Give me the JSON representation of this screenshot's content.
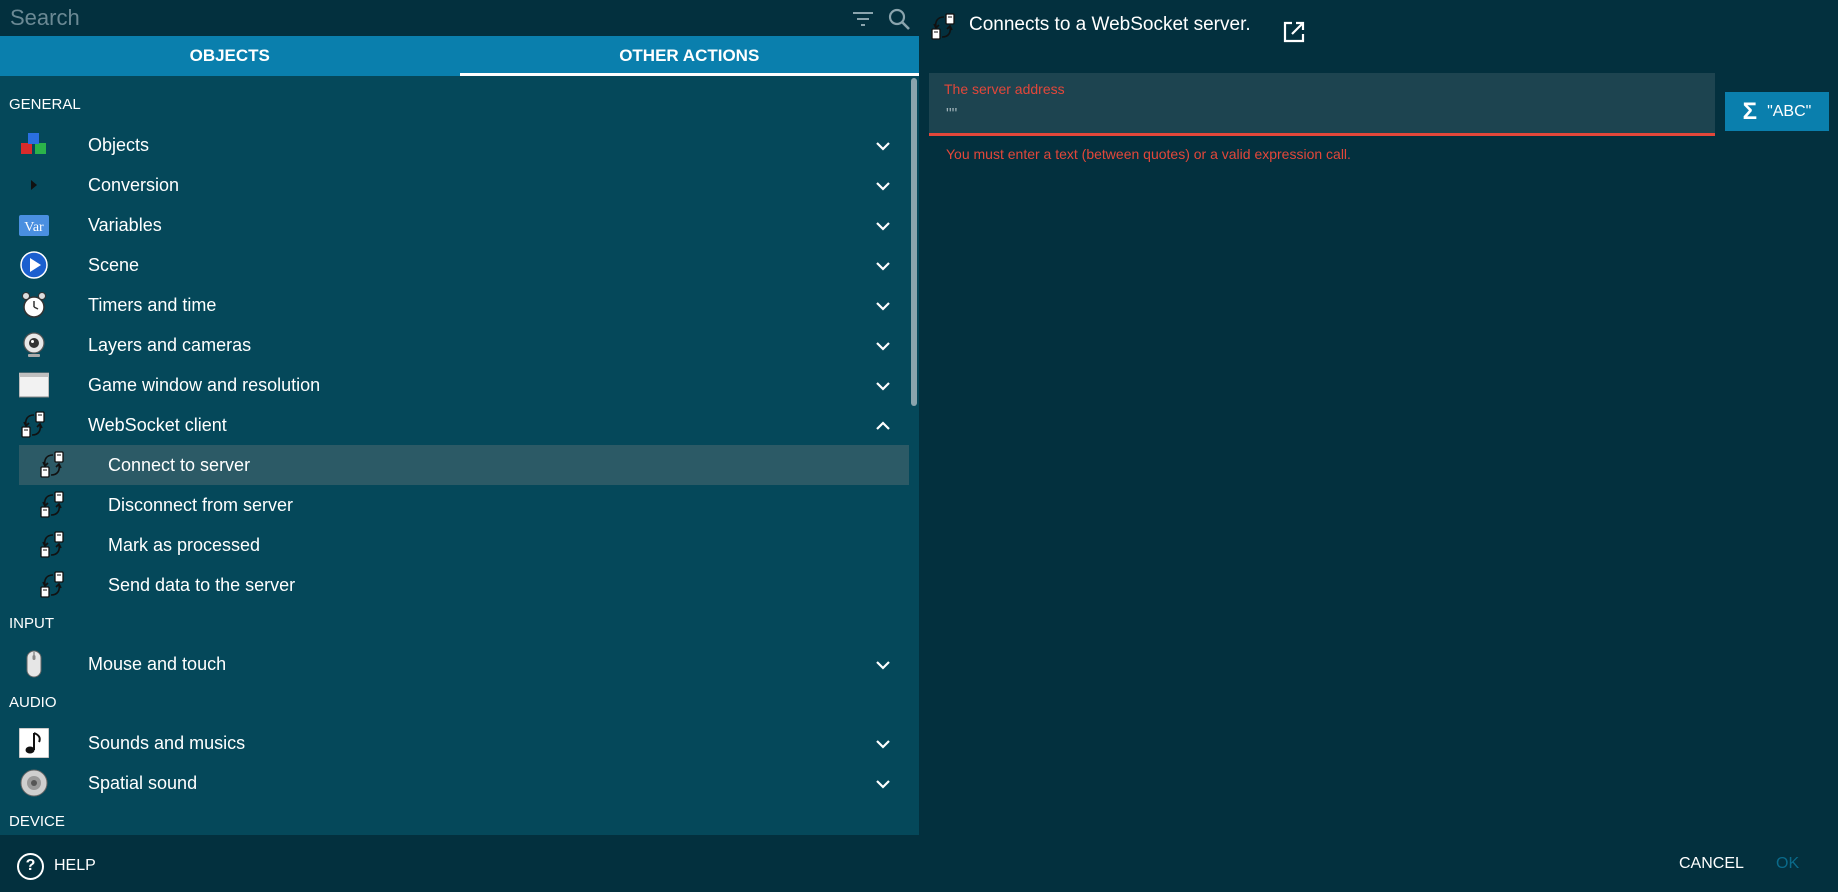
{
  "search": {
    "placeholder": "Search"
  },
  "tabs": [
    {
      "label": "OBJECTS"
    },
    {
      "label": "OTHER ACTIONS",
      "active": true
    }
  ],
  "sections": {
    "general": "GENERAL",
    "input": "INPUT",
    "audio": "AUDIO",
    "device": "DEVICE"
  },
  "items": {
    "objects": "Objects",
    "conversion": "Conversion",
    "variables": "Variables",
    "scene": "Scene",
    "timers": "Timers and time",
    "layers": "Layers and cameras",
    "game_window": "Game window and resolution",
    "websocket": "WebSocket client",
    "connect": "Connect to server",
    "disconnect": "Disconnect from server",
    "mark_processed": "Mark as processed",
    "send_data": "Send data to the server",
    "mouse": "Mouse and touch",
    "sounds": "Sounds and musics",
    "spatial": "Spatial sound"
  },
  "icons": {
    "variables_text": "Var"
  },
  "detail": {
    "description": "Connects to a WebSocket server.",
    "field_label": "The server address",
    "field_value": "\"\"",
    "error": "You must enter a text (between quotes) or a valid expression call.",
    "abc_label": "\"ABC\""
  },
  "footer": {
    "help": "HELP",
    "cancel": "CANCEL",
    "ok": "OK"
  },
  "colors": {
    "accent": "#0a7fad",
    "error": "#e3473a",
    "panel": "#05485a",
    "background": "#03303e",
    "selected_row": "#2c5a66"
  }
}
